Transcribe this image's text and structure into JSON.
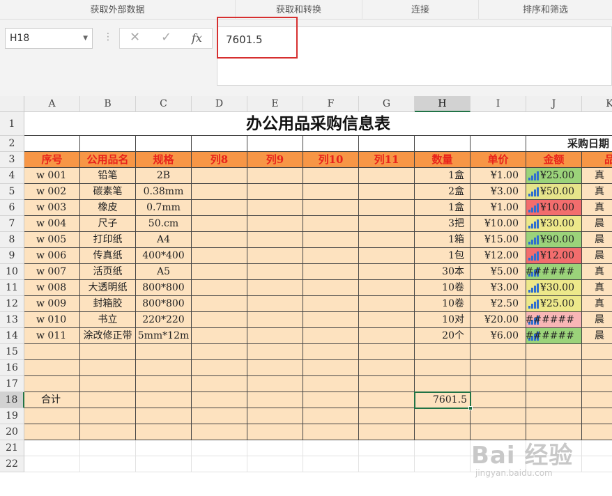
{
  "ribbon": {
    "groups": [
      "获取外部数据",
      "获取和转换",
      "连接",
      "排序和筛选"
    ]
  },
  "formula_bar": {
    "name_box": "H18",
    "value": "7601.5",
    "fx_label": "fx",
    "cancel_glyph": "✕",
    "enter_glyph": "✓"
  },
  "columns": [
    "A",
    "B",
    "C",
    "D",
    "E",
    "F",
    "G",
    "H",
    "I",
    "J",
    "K"
  ],
  "rows": [
    "1",
    "2",
    "3",
    "4",
    "5",
    "6",
    "7",
    "8",
    "9",
    "10",
    "11",
    "12",
    "13",
    "14",
    "15",
    "16",
    "17",
    "18",
    "19",
    "20",
    "21",
    "22"
  ],
  "sheet": {
    "title": "办公用品采购信息表",
    "purchase_date_label": "采购日期",
    "headers": [
      "序号",
      "公用品名",
      "规格",
      "列8",
      "列9",
      "列10",
      "列11",
      "数量",
      "单价",
      "金额",
      "品"
    ],
    "data_rows": [
      [
        "w 001",
        "铅笔",
        "2B",
        "",
        "",
        "",
        "",
        "1盒",
        "¥1.00",
        "¥25.00",
        "真"
      ],
      [
        "w 002",
        "碳素笔",
        "0.38mm",
        "",
        "",
        "",
        "",
        "2盒",
        "¥3.00",
        "¥50.00",
        "真"
      ],
      [
        "w 003",
        "橡皮",
        "0.7mm",
        "",
        "",
        "",
        "",
        "1盒",
        "¥1.00",
        "¥10.00",
        "真"
      ],
      [
        "w 004",
        "尺子",
        "50.cm",
        "",
        "",
        "",
        "",
        "3把",
        "¥10.00",
        "¥30.00",
        "晨"
      ],
      [
        "w 005",
        "打印纸",
        "A4",
        "",
        "",
        "",
        "",
        "1箱",
        "¥15.00",
        "¥90.00",
        "晨"
      ],
      [
        "w 006",
        "传真纸",
        "400*400",
        "",
        "",
        "",
        "",
        "1包",
        "¥12.00",
        "¥12.00",
        "晨"
      ],
      [
        "w 007",
        "活页纸",
        "A5",
        "",
        "",
        "",
        "",
        "30本",
        "¥5.00",
        "######",
        "真"
      ],
      [
        "w 008",
        "大透明纸",
        "800*800",
        "",
        "",
        "",
        "",
        "10卷",
        "¥3.00",
        "¥30.00",
        "真"
      ],
      [
        "w 009",
        "封箱胶",
        "800*800",
        "",
        "",
        "",
        "",
        "10卷",
        "¥2.50",
        "¥25.00",
        "真"
      ],
      [
        "w 010",
        "书立",
        "220*220",
        "",
        "",
        "",
        "",
        "10对",
        "¥20.00",
        "######",
        "晨"
      ],
      [
        "w 011",
        "涂改修正带",
        "5mm*12m",
        "",
        "",
        "",
        "",
        "20个",
        "¥6.00",
        "######",
        "晨"
      ]
    ],
    "total_label": "合计",
    "total_value": "7601.5"
  },
  "colors": {
    "header_fill": "#f79646",
    "row_fill": "#fde2bf",
    "header_text": "#e8231b",
    "selection": "#217346",
    "highlight_box": "#d62f2f",
    "cf_green": "#9bd37a",
    "cf_yellow": "#ede88a",
    "cf_red": "#f26d6d",
    "cf_pink": "#f8b6b6"
  },
  "amount_fills": [
    "#9bd37a",
    "#e6e48a",
    "#f26d6d",
    "#ede88a",
    "#9bd37a",
    "#f26d6d",
    "#9bd37a",
    "#ede88a",
    "#ede88a",
    "#f8b6b6",
    "#9bd37a"
  ],
  "watermark": {
    "brand": "Bai 经验",
    "url": "jingyan.baidu.com"
  }
}
